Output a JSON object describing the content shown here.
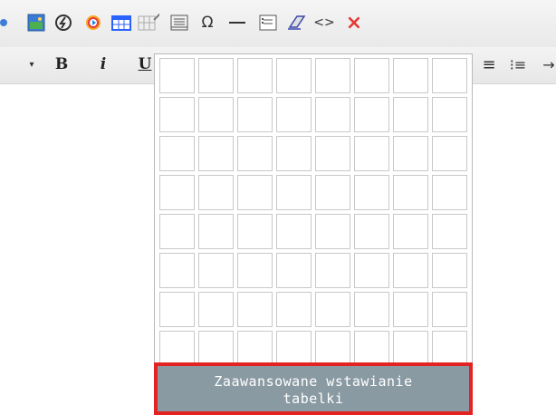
{
  "toolbar": {
    "icons": [
      "link-partial-icon",
      "image-icon",
      "flash-icon",
      "media-icon",
      "table-icon",
      "table-edit-icon",
      "paragraph-icon",
      "special-char-icon",
      "horizontal-rule-icon",
      "form-icon",
      "eraser-icon",
      "code-view-icon",
      "close-icon"
    ],
    "omega": "Ω",
    "code": "<>",
    "close": "×"
  },
  "format": {
    "dropdown_arrow": "▾",
    "bold": "B",
    "italic": "i",
    "underline": "U",
    "align_right_glyph": "≡",
    "list_glyph": "⁝≡",
    "indent_glyph": "→"
  },
  "table_picker": {
    "rows": 8,
    "cols": 8,
    "advanced_label_line1": "Zaawansowane wstawianie",
    "advanced_label_line2": "tabelki"
  },
  "colors": {
    "highlight_border": "#e32222",
    "button_bg": "#8a9aa3"
  }
}
